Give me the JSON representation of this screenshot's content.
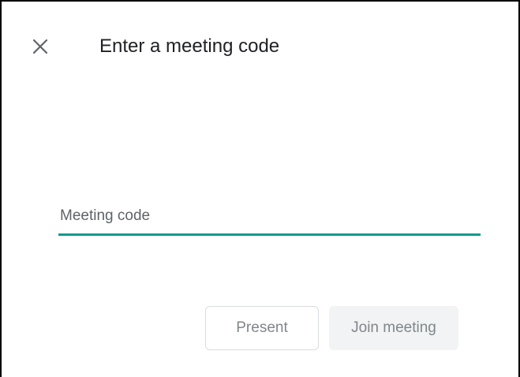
{
  "dialog": {
    "title": "Enter a meeting code",
    "close_icon": "close-icon"
  },
  "meeting_code": {
    "placeholder": "Meeting code",
    "value": "",
    "accent_color": "#129a8c"
  },
  "actions": {
    "present_label": "Present",
    "join_label": "Join meeting"
  }
}
